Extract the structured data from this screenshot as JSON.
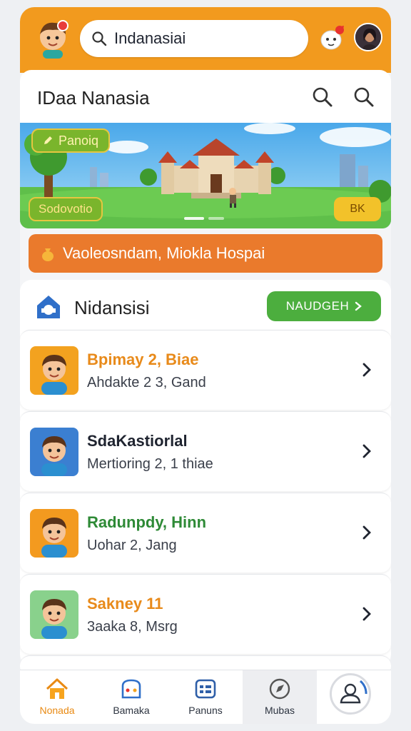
{
  "header": {
    "search_value": "Indanasiai",
    "search_placeholder": "Indanasiai"
  },
  "title_card": {
    "title": "IDaa Nanasia"
  },
  "banner": {
    "top_pill": "Panoiq",
    "bottom_left_pill": "Sodovotio",
    "bottom_right_pill": "BK"
  },
  "notice": {
    "text": "Vaoleosndam, Miokla Hospai"
  },
  "section": {
    "title": "Nidansisi",
    "button_label": "NAUDGEH"
  },
  "list": [
    {
      "name": "Bpimay 2, Biae",
      "sub": "Ahdakte 2 3, Gand",
      "name_color": "#e88a1a",
      "thumb_bg": "#f3a21f"
    },
    {
      "name": "SdaKastiorlal",
      "sub": "Mertioring 2, 1 thiae",
      "name_color": "#1f2430",
      "thumb_bg": "#3b7fd1"
    },
    {
      "name": "Radunpdy, Hinn",
      "sub": "Uohar 2, Jang",
      "name_color": "#2e8a36",
      "thumb_bg": "#f39a1f"
    },
    {
      "name": "Sakney 11",
      "sub": "3aaka 8, Msrg",
      "name_color": "#e88a1a",
      "thumb_bg": "#89d18c"
    }
  ],
  "nav": {
    "items": [
      {
        "label": "Nonada"
      },
      {
        "label": "Bamaka"
      },
      {
        "label": "Panuns"
      },
      {
        "label": "Mubas"
      }
    ]
  },
  "colors": {
    "brand_orange": "#f29a1e",
    "notice_orange": "#ea7a2c",
    "button_green": "#4cae3e"
  }
}
